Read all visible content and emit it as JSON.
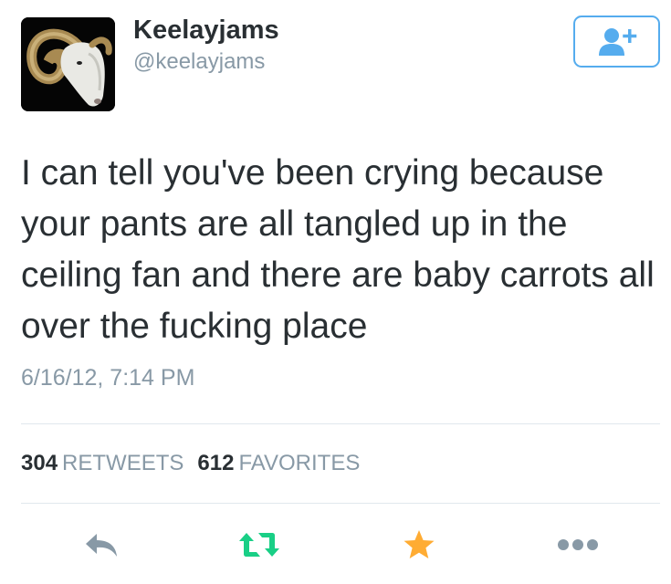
{
  "user": {
    "display_name": "Keelayjams",
    "handle": "@keelayjams",
    "avatar_icon": "ram-avatar-icon"
  },
  "follow_button": {
    "icon": "follow-user-plus-icon",
    "color": "#55acee"
  },
  "tweet": {
    "text": "I can tell you've been crying because your pants are all tangled up in the ceiling fan and there are baby carrots all over the fucking place",
    "timestamp": "6/16/12, 7:14 PM"
  },
  "stats": {
    "retweets_count": "304",
    "retweets_label": "RETWEETS",
    "favorites_count": "612",
    "favorites_label": "FAVORITES"
  },
  "actions": [
    {
      "name": "reply",
      "icon": "reply-arrow-icon",
      "color": "#8899a6"
    },
    {
      "name": "retweet",
      "icon": "retweet-icon",
      "color": "#19cf86"
    },
    {
      "name": "favorite",
      "icon": "star-icon",
      "color": "#ffac33"
    },
    {
      "name": "more",
      "icon": "more-dots-icon",
      "color": "#8899a6"
    }
  ]
}
